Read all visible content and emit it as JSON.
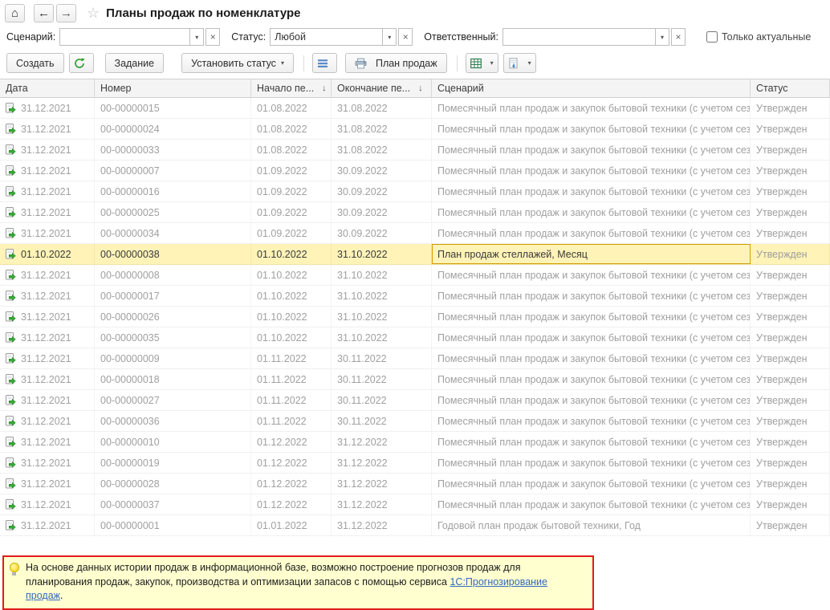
{
  "icons": {
    "home": "⌂",
    "back": "←",
    "forward": "→",
    "favorite": "☆",
    "dropdown": "▾",
    "clear": "×"
  },
  "titlebar": {
    "title": "Планы продаж по номенклатуре"
  },
  "filters": {
    "scenario": {
      "label": "Сценарий:",
      "value": ""
    },
    "status": {
      "label": "Статус:",
      "value": "Любой"
    },
    "responsible": {
      "label": "Ответственный:",
      "value": ""
    },
    "only_actual": {
      "label": "Только актуальные",
      "checked": false
    }
  },
  "toolbar": {
    "create": "Создать",
    "task": "Задание",
    "set_status": "Установить статус",
    "sales_plan": "План продаж"
  },
  "table": {
    "columns": [
      {
        "key": "date",
        "label": "Дата",
        "sort": ""
      },
      {
        "key": "number",
        "label": "Номер",
        "sort": ""
      },
      {
        "key": "start",
        "label": "Начало пе...",
        "sort": "↓"
      },
      {
        "key": "end",
        "label": "Окончание пе...",
        "sort": "↓"
      },
      {
        "key": "scenario",
        "label": "Сценарий",
        "sort": ""
      },
      {
        "key": "status",
        "label": "Статус",
        "sort": ""
      }
    ],
    "rows": [
      {
        "date": "31.12.2021",
        "number": "00-00000015",
        "start": "01.08.2022",
        "end": "31.08.2022",
        "scenario": "Помесячный план продаж и закупок бытовой техники (с учетом сез...",
        "status": "Утвержден",
        "selected": false
      },
      {
        "date": "31.12.2021",
        "number": "00-00000024",
        "start": "01.08.2022",
        "end": "31.08.2022",
        "scenario": "Помесячный план продаж и закупок бытовой техники (с учетом сез...",
        "status": "Утвержден",
        "selected": false
      },
      {
        "date": "31.12.2021",
        "number": "00-00000033",
        "start": "01.08.2022",
        "end": "31.08.2022",
        "scenario": "Помесячный план продаж и закупок бытовой техники (с учетом сез...",
        "status": "Утвержден",
        "selected": false
      },
      {
        "date": "31.12.2021",
        "number": "00-00000007",
        "start": "01.09.2022",
        "end": "30.09.2022",
        "scenario": "Помесячный план продаж и закупок бытовой техники (с учетом сез...",
        "status": "Утвержден",
        "selected": false
      },
      {
        "date": "31.12.2021",
        "number": "00-00000016",
        "start": "01.09.2022",
        "end": "30.09.2022",
        "scenario": "Помесячный план продаж и закупок бытовой техники (с учетом сез...",
        "status": "Утвержден",
        "selected": false
      },
      {
        "date": "31.12.2021",
        "number": "00-00000025",
        "start": "01.09.2022",
        "end": "30.09.2022",
        "scenario": "Помесячный план продаж и закупок бытовой техники (с учетом сез...",
        "status": "Утвержден",
        "selected": false
      },
      {
        "date": "31.12.2021",
        "number": "00-00000034",
        "start": "01.09.2022",
        "end": "30.09.2022",
        "scenario": "Помесячный план продаж и закупок бытовой техники (с учетом сез...",
        "status": "Утвержден",
        "selected": false
      },
      {
        "date": "01.10.2022",
        "number": "00-00000038",
        "start": "01.10.2022",
        "end": "31.10.2022",
        "scenario": "План продаж стеллажей, Месяц",
        "status": "Утвержден",
        "selected": true
      },
      {
        "date": "31.12.2021",
        "number": "00-00000008",
        "start": "01.10.2022",
        "end": "31.10.2022",
        "scenario": "Помесячный план продаж и закупок бытовой техники (с учетом сез...",
        "status": "Утвержден",
        "selected": false
      },
      {
        "date": "31.12.2021",
        "number": "00-00000017",
        "start": "01.10.2022",
        "end": "31.10.2022",
        "scenario": "Помесячный план продаж и закупок бытовой техники (с учетом сез...",
        "status": "Утвержден",
        "selected": false
      },
      {
        "date": "31.12.2021",
        "number": "00-00000026",
        "start": "01.10.2022",
        "end": "31.10.2022",
        "scenario": "Помесячный план продаж и закупок бытовой техники (с учетом сез...",
        "status": "Утвержден",
        "selected": false
      },
      {
        "date": "31.12.2021",
        "number": "00-00000035",
        "start": "01.10.2022",
        "end": "31.10.2022",
        "scenario": "Помесячный план продаж и закупок бытовой техники (с учетом сез...",
        "status": "Утвержден",
        "selected": false
      },
      {
        "date": "31.12.2021",
        "number": "00-00000009",
        "start": "01.11.2022",
        "end": "30.11.2022",
        "scenario": "Помесячный план продаж и закупок бытовой техники (с учетом сез...",
        "status": "Утвержден",
        "selected": false
      },
      {
        "date": "31.12.2021",
        "number": "00-00000018",
        "start": "01.11.2022",
        "end": "30.11.2022",
        "scenario": "Помесячный план продаж и закупок бытовой техники (с учетом сез...",
        "status": "Утвержден",
        "selected": false
      },
      {
        "date": "31.12.2021",
        "number": "00-00000027",
        "start": "01.11.2022",
        "end": "30.11.2022",
        "scenario": "Помесячный план продаж и закупок бытовой техники (с учетом сез...",
        "status": "Утвержден",
        "selected": false
      },
      {
        "date": "31.12.2021",
        "number": "00-00000036",
        "start": "01.11.2022",
        "end": "30.11.2022",
        "scenario": "Помесячный план продаж и закупок бытовой техники (с учетом сез...",
        "status": "Утвержден",
        "selected": false
      },
      {
        "date": "31.12.2021",
        "number": "00-00000010",
        "start": "01.12.2022",
        "end": "31.12.2022",
        "scenario": "Помесячный план продаж и закупок бытовой техники (с учетом сез...",
        "status": "Утвержден",
        "selected": false
      },
      {
        "date": "31.12.2021",
        "number": "00-00000019",
        "start": "01.12.2022",
        "end": "31.12.2022",
        "scenario": "Помесячный план продаж и закупок бытовой техники (с учетом сез...",
        "status": "Утвержден",
        "selected": false
      },
      {
        "date": "31.12.2021",
        "number": "00-00000028",
        "start": "01.12.2022",
        "end": "31.12.2022",
        "scenario": "Помесячный план продаж и закупок бытовой техники (с учетом сез...",
        "status": "Утвержден",
        "selected": false
      },
      {
        "date": "31.12.2021",
        "number": "00-00000037",
        "start": "01.12.2022",
        "end": "31.12.2022",
        "scenario": "Помесячный план продаж и закупок бытовой техники (с учетом сез...",
        "status": "Утвержден",
        "selected": false
      },
      {
        "date": "31.12.2021",
        "number": "00-00000001",
        "start": "01.01.2022",
        "end": "31.12.2022",
        "scenario": "Годовой план продаж бытовой техники, Год",
        "status": "Утвержден",
        "selected": false
      }
    ]
  },
  "infobox": {
    "text": "На основе данных истории продаж в информационной базе, возможно построение прогнозов продаж для планирования продаж, закупок, производства и оптимизации запасов с помощью сервиса ",
    "link": "1С:Прогнозирование продаж",
    "suffix": "."
  }
}
